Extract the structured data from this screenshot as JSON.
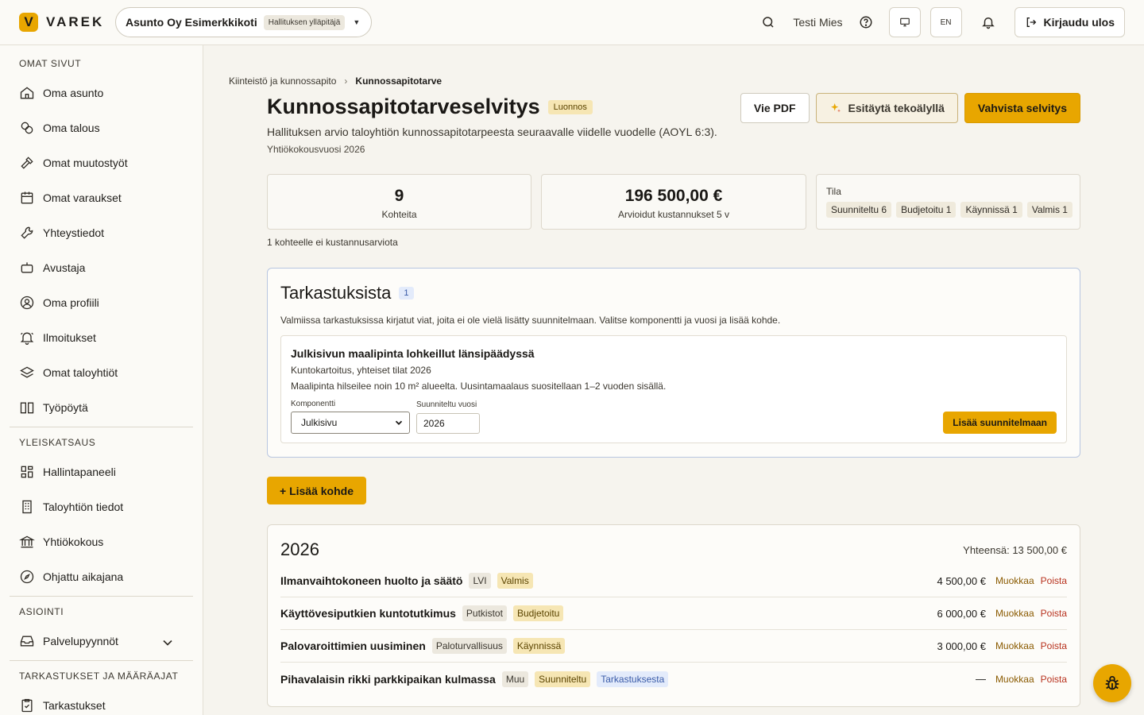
{
  "app": {
    "logo_letter": "V",
    "logo_text": "VAREK",
    "org_name": "Asunto Oy Esimerkkikoti",
    "org_role": "Hallituksen ylläpitäjä",
    "user_name": "Testi Mies",
    "lang": "EN",
    "logout_label": "Kirjaudu ulos",
    "accent_color": "#e8a600"
  },
  "sidebar": {
    "sections": [
      {
        "title": "OMAT SIVUT",
        "items": [
          {
            "label": "Oma asunto",
            "icon": "home-icon"
          },
          {
            "label": "Oma talous",
            "icon": "coins-icon"
          },
          {
            "label": "Omat muutostyöt",
            "icon": "hammer-icon"
          },
          {
            "label": "Omat varaukset",
            "icon": "calendar-icon"
          },
          {
            "label": "Yhteystiedot",
            "icon": "wrench-icon"
          },
          {
            "label": "Avustaja",
            "icon": "bot-icon"
          },
          {
            "label": "Oma profiili",
            "icon": "user-circle-icon"
          },
          {
            "label": "Ilmoitukset",
            "icon": "bell-ring-icon"
          },
          {
            "label": "Omat taloyhtiöt",
            "icon": "layers-icon"
          },
          {
            "label": "Työpöytä",
            "icon": "book-open-icon"
          }
        ]
      },
      {
        "title": "YLEISKATSAUS",
        "items": [
          {
            "label": "Hallintapaneeli",
            "icon": "dashboard-icon"
          },
          {
            "label": "Taloyhtiön tiedot",
            "icon": "building-icon"
          },
          {
            "label": "Yhtiökokous",
            "icon": "landmark-icon"
          },
          {
            "label": "Ohjattu aikajana",
            "icon": "compass-icon"
          }
        ]
      },
      {
        "title": "ASIOINTI",
        "items": [
          {
            "label": "Palvelupyynnöt",
            "icon": "inbox-icon"
          }
        ]
      },
      {
        "title": "TARKASTUKSET JA MÄÄRÄAJAT",
        "items": [
          {
            "label": "Tarkastukset",
            "icon": "clipboard-check-icon"
          }
        ]
      }
    ]
  },
  "breadcrumb": {
    "parent": "Kiinteistö ja kunnossapito",
    "current": "Kunnossapitotarve"
  },
  "page": {
    "title": "Kunnossapitotarveselvitys",
    "status": "Luonnos",
    "subtitle": "Hallituksen arvio taloyhtiön kunnossapitotarpeesta seuraavalle viidelle vuodelle (AOYL 6:3).",
    "year_line": "Yhtiökokousvuosi 2026",
    "btn_pdf": "Vie PDF",
    "btn_ai": "Esitäytä tekoälyllä",
    "btn_confirm": "Vahvista selvitys"
  },
  "stats": {
    "count_value": "9",
    "count_label": "Kohteita",
    "cost_value": "196 500,00 €",
    "cost_label": "Arvioidut kustannukset 5 v",
    "state_label": "Tila",
    "states": [
      "Suunniteltu 6",
      "Budjetoitu 1",
      "Käynnissä 1",
      "Valmis 1"
    ],
    "missing_note": "1 kohteelle ei kustannusarviota"
  },
  "inspections": {
    "title": "Tarkastuksista",
    "count": "1",
    "description": "Valmiissa tarkastuksissa kirjatut viat, joita ei ole vielä lisätty suunnitelmaan. Valitse komponentti ja vuosi ja lisää kohde.",
    "card": {
      "title": "Julkisivun maalipinta lohkeillut länsipäädyssä",
      "source": "Kuntokartoitus, yhteiset tilat 2026",
      "description": "Maalipinta hilseilee noin 10 m² alueelta. Uusintamaalaus suositellaan 1–2 vuoden sisällä.",
      "component_label": "Komponentti",
      "component_value": "Julkisivu",
      "year_label": "Suunniteltu vuosi",
      "year_value": "2026",
      "add_label": "Lisää suunnitelmaan"
    }
  },
  "add_item_label": "+ Lisää kohde",
  "year_group": {
    "year": "2026",
    "total": "Yhteensä: 13 500,00 €",
    "edit_label": "Muokkaa",
    "delete_label": "Poista",
    "rows": [
      {
        "name": "Ilmanvaihtokoneen huolto ja säätö",
        "category": "LVI",
        "status": "Valmis",
        "source": "",
        "amount": "4 500,00 €"
      },
      {
        "name": "Käyttövesiputkien kuntotutkimus",
        "category": "Putkistot",
        "status": "Budjetoitu",
        "source": "",
        "amount": "6 000,00 €"
      },
      {
        "name": "Palovaroittimien uusiminen",
        "category": "Paloturvallisuus",
        "status": "Käynnissä",
        "source": "",
        "amount": "3 000,00 €"
      },
      {
        "name": "Pihavalaisin rikki parkkipaikan kulmassa",
        "category": "Muu",
        "status": "Suunniteltu",
        "source": "Tarkastuksesta",
        "amount": "—"
      }
    ]
  }
}
